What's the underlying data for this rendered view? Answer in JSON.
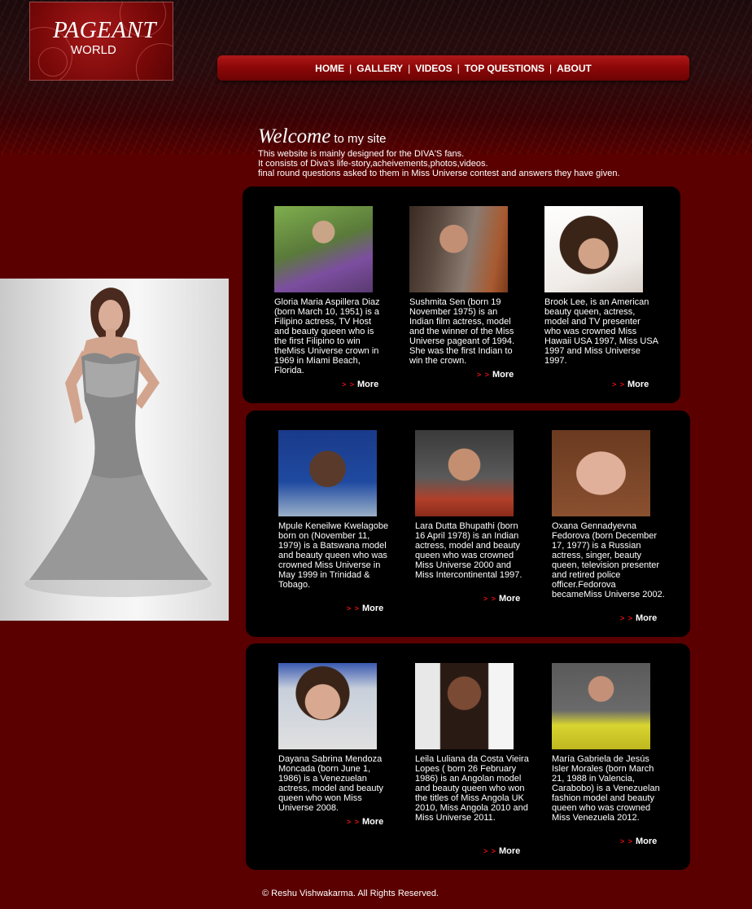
{
  "header": {
    "logo_line1": "PAGEANT",
    "logo_line2": "WORLD"
  },
  "nav": [
    "HOME",
    "GALLERY",
    "VIDEOS",
    "TOP QUESTIONS",
    "ABOUT"
  ],
  "welcome": {
    "title_big": "Welcome",
    "title_small": "to my site",
    "lines": [
      "This website is mainly designed for the DIVA'S fans.",
      "It consists of Diva's life-story,acheivements,photos,videos.",
      "final round questions asked to them in Miss Universe contest and answers they have given."
    ]
  },
  "more_label": "More",
  "more_arrow": "> >",
  "cards": [
    {
      "text": "Gloria Maria Aspillera Diaz (born March 10, 1951) is a Filipino actress, TV Host and beauty queen who is the first Filipino to win theMiss Universe crown in 1969 in Miami Beach, Florida."
    },
    {
      "text": "Sushmita Sen (born 19 November 1975) is an Indian film actress, model and the winner of the Miss Universe pageant of 1994. She was the first Indian to win the crown."
    },
    {
      "text": "Brook Lee, is an American beauty queen, actress, model and TV presenter who was crowned Miss Hawaii USA 1997, Miss USA 1997 and Miss Universe 1997."
    },
    {
      "text": "Mpule Keneilwe Kwelagobe born on (November 11, 1979) is a Batswana model and beauty queen who was crowned Miss Universe in May 1999 in Trinidad & Tobago."
    },
    {
      "text": "Lara Dutta Bhupathi (born 16 April 1978) is an Indian actress, model and beauty queen who was crowned Miss Universe 2000 and Miss Intercontinental 1997."
    },
    {
      "text": "Oxana Gennadyevna Fedorova (born December 17, 1977) is a Russian actress, singer, beauty queen, television presenter and retired police officer.Fedorova becameMiss Universe 2002."
    },
    {
      "text": "Dayana Sabrina Mendoza Moncada (born June 1, 1986) is a Venezuelan actress, model and beauty queen who won Miss Universe 2008."
    },
    {
      "text": "Leila Luliana da Costa Vieira Lopes ( born 26 February 1986) is an Angolan model and beauty queen who won the titles of Miss Angola UK 2010, Miss Angola 2010 and Miss Universe 2011."
    },
    {
      "text": "María Gabriela de Jesús Isler Morales (born March 21, 1988 in Valencia, Carabobo) is a Venezuelan fashion model and beauty queen who was crowned Miss Venezuela 2012."
    }
  ],
  "footer": "© Reshu Vishwakarma. All Rights Reserved."
}
